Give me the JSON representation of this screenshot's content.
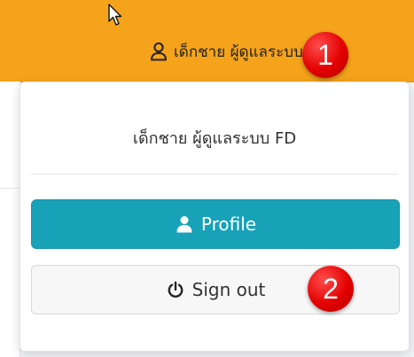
{
  "topbar": {
    "background": "#f5a31a",
    "user_label": "เด็กชาย ผู้ดูแลระบบ FD",
    "user_icon": "user-outline-icon"
  },
  "dropdown": {
    "user_name": "เด็กชาย ผู้ดูแลระบบ FD",
    "profile_button": {
      "label": "Profile",
      "icon": "user-icon",
      "background": "#17a2b8"
    },
    "signout_button": {
      "label": "Sign out",
      "icon": "power-icon"
    }
  },
  "annotations": {
    "badge_1": "1",
    "badge_2": "2",
    "badge_color": "#e30000"
  }
}
